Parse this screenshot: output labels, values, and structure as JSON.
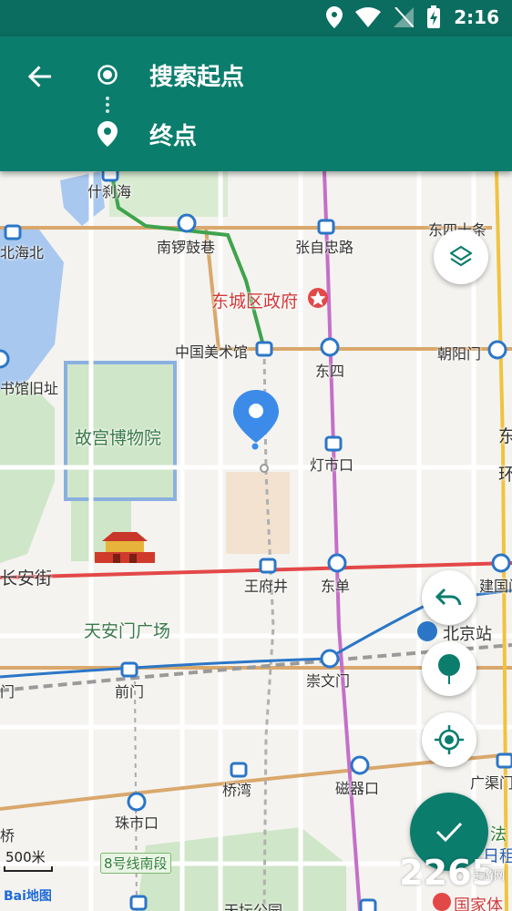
{
  "status": {
    "time": "2:16"
  },
  "header": {
    "start_label": "搜索起点",
    "end_label": "终点"
  },
  "map": {
    "labels": {
      "shichahai": "什刹海",
      "beihai_north": "北海北",
      "nanluoguxiang": "南锣鼓巷",
      "zhangzizhonglu": "张自忠路",
      "dongsishitiao": "东四十条",
      "dongcheng_gov": "东城区政府",
      "national_library_site": "书馆旧址",
      "china_art_museum": "中国美术馆",
      "dongsi": "东四",
      "chaoyangmen": "朝阳门",
      "palace_museum": "故宫博物院",
      "dengshikou": "灯市口",
      "dong_right": "东",
      "huan_right": "环",
      "changan_street": "长安街",
      "wangfujing": "王府井",
      "dongdan": "东单",
      "jianguomen": "建国门",
      "tiananmen_square": "天安门广场",
      "beijing_station": "北京站",
      "men_left": "门",
      "qianmen": "前门",
      "chongwenmen": "崇文门",
      "qiaowan": "桥湾",
      "ciqikou": "磁器口",
      "guangqumen": "广渠门",
      "qiao_left": "桥",
      "zhushikou": "珠市口",
      "line8_south": "8号线南段",
      "tiantan_park": "天坛公园",
      "fa_right": "法",
      "ri_right": "日租",
      "national_right": "国家体"
    },
    "scale_text": "500米",
    "baidu_logo": "Bai地图",
    "watermark": "2265",
    "watermark_sub": "手游网"
  },
  "colors": {
    "header_bg": "#0b7d6d",
    "status_bg": "#0b6d5f",
    "pin": "#3d8be8",
    "line_orange": "#c8955a",
    "line_red": "#e34848",
    "line_purple": "#c46fc8",
    "line_green": "#3fa34d",
    "line_blue": "#2b76c7"
  }
}
